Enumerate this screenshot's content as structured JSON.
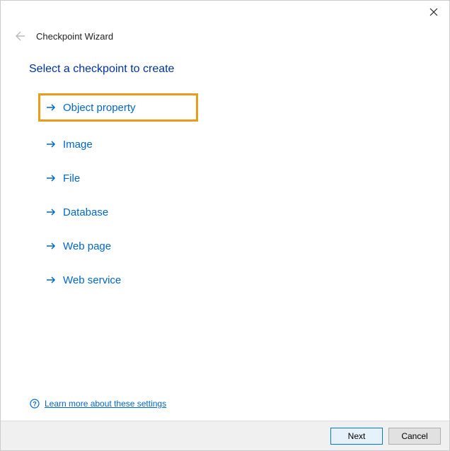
{
  "window": {
    "title": "Checkpoint Wizard"
  },
  "heading": "Select a checkpoint to create",
  "options": [
    {
      "label": "Object property",
      "highlighted": true
    },
    {
      "label": "Image",
      "highlighted": false
    },
    {
      "label": "File",
      "highlighted": false
    },
    {
      "label": "Database",
      "highlighted": false
    },
    {
      "label": "Web page",
      "highlighted": false
    },
    {
      "label": "Web service",
      "highlighted": false
    }
  ],
  "help": {
    "text": "Learn more about these settings"
  },
  "buttons": {
    "next": "Next",
    "cancel": "Cancel"
  }
}
